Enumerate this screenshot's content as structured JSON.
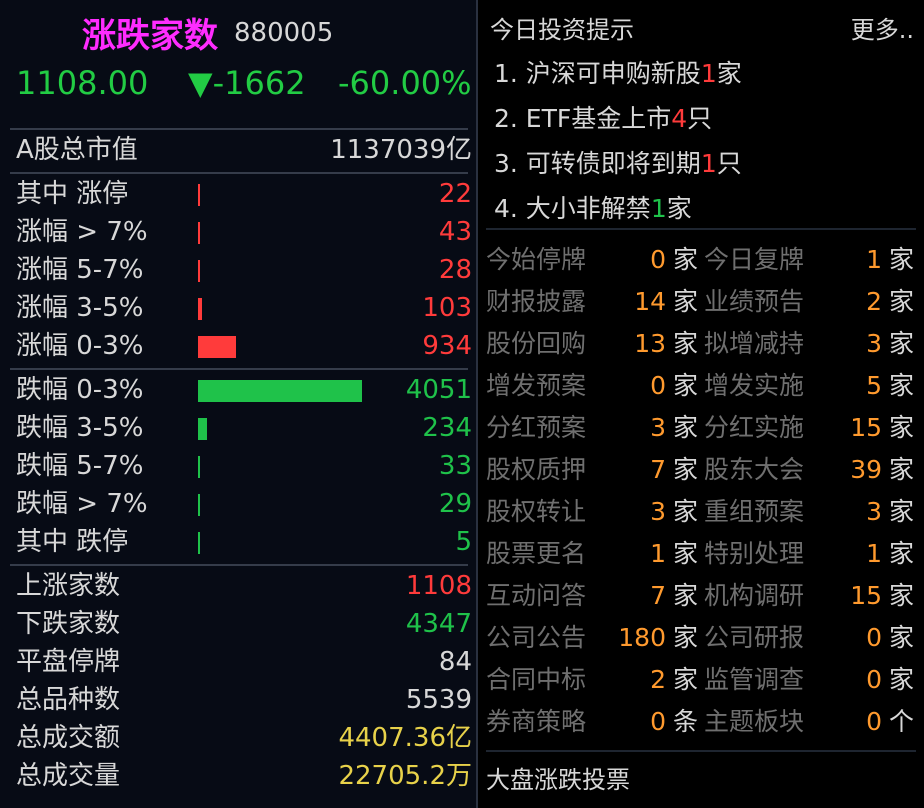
{
  "header": {
    "title": "涨跌家数",
    "code": "880005",
    "price": "1108.00",
    "change": "▼-1662",
    "change_pct": "-60.00%"
  },
  "market_cap": {
    "label": "A股总市值",
    "value": "1137039亿"
  },
  "rise_rows": [
    {
      "label": "其中 涨停",
      "value": "22",
      "count": 22
    },
    {
      "label": "涨幅 > 7%",
      "value": "43",
      "count": 43
    },
    {
      "label": "涨幅 5-7%",
      "value": "28",
      "count": 28
    },
    {
      "label": "涨幅 3-5%",
      "value": "103",
      "count": 103
    },
    {
      "label": "涨幅 0-3%",
      "value": "934",
      "count": 934
    }
  ],
  "fall_rows": [
    {
      "label": "跌幅 0-3%",
      "value": "4051",
      "count": 4051
    },
    {
      "label": "跌幅 3-5%",
      "value": "234",
      "count": 234
    },
    {
      "label": "跌幅 5-7%",
      "value": "33",
      "count": 33
    },
    {
      "label": "跌幅 > 7%",
      "value": "29",
      "count": 29
    },
    {
      "label": "其中 跌停",
      "value": "5",
      "count": 5
    }
  ],
  "summary": [
    {
      "label": "上涨家数",
      "value": "1108",
      "color": "#ff3b3b"
    },
    {
      "label": "下跌家数",
      "value": "4347",
      "color": "#1fc24a"
    },
    {
      "label": "平盘停牌",
      "value": "84",
      "color": "#d8d8d8"
    },
    {
      "label": "总品种数",
      "value": "5539",
      "color": "#d8d8d8"
    },
    {
      "label": "总成交额",
      "value": "4407.36亿",
      "color": "#e8d24a"
    },
    {
      "label": "总成交量",
      "value": "22705.2万",
      "color": "#e8d24a"
    }
  ],
  "tips": {
    "title": "今日投资提示",
    "more": "更多..",
    "items": [
      {
        "pre": "1. 沪深可申购新股",
        "num": "1",
        "post": "家",
        "num_color": "#ff3b3b"
      },
      {
        "pre": "2. ETF基金上市",
        "num": "4",
        "post": "只",
        "num_color": "#ff3b3b"
      },
      {
        "pre": "3. 可转债即将到期",
        "num": "1",
        "post": "只",
        "num_color": "#ff3b3b"
      },
      {
        "pre": "4. 大小非解禁",
        "num": "1",
        "post": "家",
        "num_color": "#1fc24a"
      }
    ]
  },
  "events": [
    [
      {
        "name": "今始停牌",
        "count": "0",
        "unit": "家"
      },
      {
        "name": "今日复牌",
        "count": "1",
        "unit": "家"
      }
    ],
    [
      {
        "name": "财报披露",
        "count": "14",
        "unit": "家"
      },
      {
        "name": "业绩预告",
        "count": "2",
        "unit": "家"
      }
    ],
    [
      {
        "name": "股份回购",
        "count": "13",
        "unit": "家"
      },
      {
        "name": "拟增减持",
        "count": "3",
        "unit": "家"
      }
    ],
    [
      {
        "name": "增发预案",
        "count": "0",
        "unit": "家"
      },
      {
        "name": "增发实施",
        "count": "5",
        "unit": "家"
      }
    ],
    [
      {
        "name": "分红预案",
        "count": "3",
        "unit": "家"
      },
      {
        "name": "分红实施",
        "count": "15",
        "unit": "家"
      }
    ],
    [
      {
        "name": "股权质押",
        "count": "7",
        "unit": "家"
      },
      {
        "name": "股东大会",
        "count": "39",
        "unit": "家"
      }
    ],
    [
      {
        "name": "股权转让",
        "count": "3",
        "unit": "家"
      },
      {
        "name": "重组预案",
        "count": "3",
        "unit": "家"
      }
    ],
    [
      {
        "name": "股票更名",
        "count": "1",
        "unit": "家"
      },
      {
        "name": "特别处理",
        "count": "1",
        "unit": "家"
      }
    ],
    [
      {
        "name": "互动问答",
        "count": "7",
        "unit": "家"
      },
      {
        "name": "机构调研",
        "count": "15",
        "unit": "家"
      }
    ],
    [
      {
        "name": "公司公告",
        "count": "180",
        "unit": "家"
      },
      {
        "name": "公司研报",
        "count": "0",
        "unit": "家"
      }
    ],
    [
      {
        "name": "合同中标",
        "count": "2",
        "unit": "家"
      },
      {
        "name": "监管调查",
        "count": "0",
        "unit": "家"
      }
    ],
    [
      {
        "name": "券商策略",
        "count": "0",
        "unit": "条"
      },
      {
        "name": "主题板块",
        "count": "0",
        "unit": "个"
      }
    ]
  ],
  "footer": "大盘涨跌投票",
  "colors": {
    "up": "#ff3b3b",
    "down": "#1fc24a",
    "accent": "#ff2cff",
    "event_count": "#ff9a2e"
  }
}
